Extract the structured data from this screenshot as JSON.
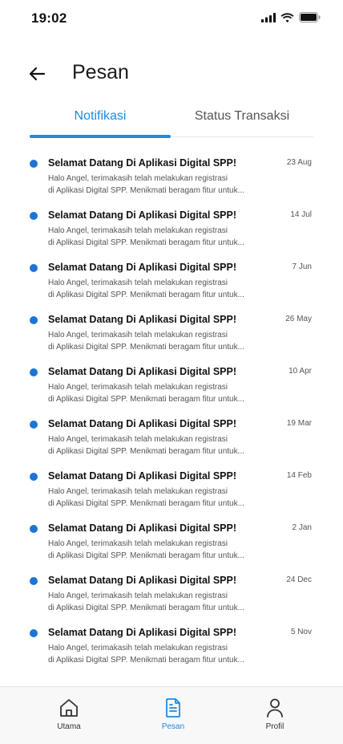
{
  "status_bar": {
    "time": "19:02"
  },
  "header": {
    "title": "Pesan"
  },
  "tabs": [
    {
      "label": "Notifikasi",
      "active": true
    },
    {
      "label": "Status Transaksi",
      "active": false
    }
  ],
  "notifications": [
    {
      "title": "Selamat Datang Di Aplikasi Digital SPP!",
      "date": "23 Aug",
      "line1": "Halo Angel, terimakasih telah melakukan registrasi",
      "line2": "di Aplikasi Digital SPP. Menikmati beragam fitur untuk..."
    },
    {
      "title": "Selamat Datang Di Aplikasi Digital SPP!",
      "date": "14 Jul",
      "line1": "Halo Angel, terimakasih telah melakukan registrasi",
      "line2": "di Aplikasi Digital SPP. Menikmati beragam fitur untuk..."
    },
    {
      "title": "Selamat Datang Di Aplikasi Digital SPP!",
      "date": "7 Jun",
      "line1": "Halo Angel, terimakasih telah melakukan registrasi",
      "line2": "di Aplikasi Digital SPP. Menikmati beragam fitur untuk..."
    },
    {
      "title": "Selamat Datang Di Aplikasi Digital SPP!",
      "date": "26 May",
      "line1": "Halo Angel, terimakasih telah melakukan registrasi",
      "line2": "di Aplikasi Digital SPP. Menikmati beragam fitur untuk..."
    },
    {
      "title": "Selamat Datang Di Aplikasi Digital SPP!",
      "date": "10 Apr",
      "line1": "Halo Angel, terimakasih telah melakukan registrasi",
      "line2": "di Aplikasi Digital SPP. Menikmati beragam fitur untuk..."
    },
    {
      "title": "Selamat Datang Di Aplikasi Digital SPP!",
      "date": "19 Mar",
      "line1": "Halo Angel, terimakasih telah melakukan registrasi",
      "line2": "di Aplikasi Digital SPP. Menikmati beragam fitur untuk..."
    },
    {
      "title": "Selamat Datang Di Aplikasi Digital SPP!",
      "date": "14 Feb",
      "line1": "Halo Angel, terimakasih telah melakukan registrasi",
      "line2": "di Aplikasi Digital SPP. Menikmati beragam fitur untuk..."
    },
    {
      "title": "Selamat Datang Di Aplikasi Digital SPP!",
      "date": "2 Jan",
      "line1": "Halo Angel, terimakasih telah melakukan registrasi",
      "line2": "di Aplikasi Digital SPP. Menikmati beragam fitur untuk..."
    },
    {
      "title": "Selamat Datang Di Aplikasi Digital SPP!",
      "date": "24 Dec",
      "line1": "Halo Angel, terimakasih telah melakukan registrasi",
      "line2": "di Aplikasi Digital SPP. Menikmati beragam fitur untuk..."
    },
    {
      "title": "Selamat Datang Di Aplikasi Digital SPP!",
      "date": "5 Nov",
      "line1": "Halo Angel, terimakasih telah melakukan registrasi",
      "line2": "di Aplikasi Digital SPP. Menikmati beragam fitur untuk..."
    }
  ],
  "bottom_nav": [
    {
      "label": "Utama",
      "icon": "home-icon",
      "active": false
    },
    {
      "label": "Pesan",
      "icon": "document-icon",
      "active": true
    },
    {
      "label": "Profil",
      "icon": "user-icon",
      "active": false
    }
  ],
  "colors": {
    "accent": "#1c8be0",
    "unread_dot": "#1c74d6"
  }
}
